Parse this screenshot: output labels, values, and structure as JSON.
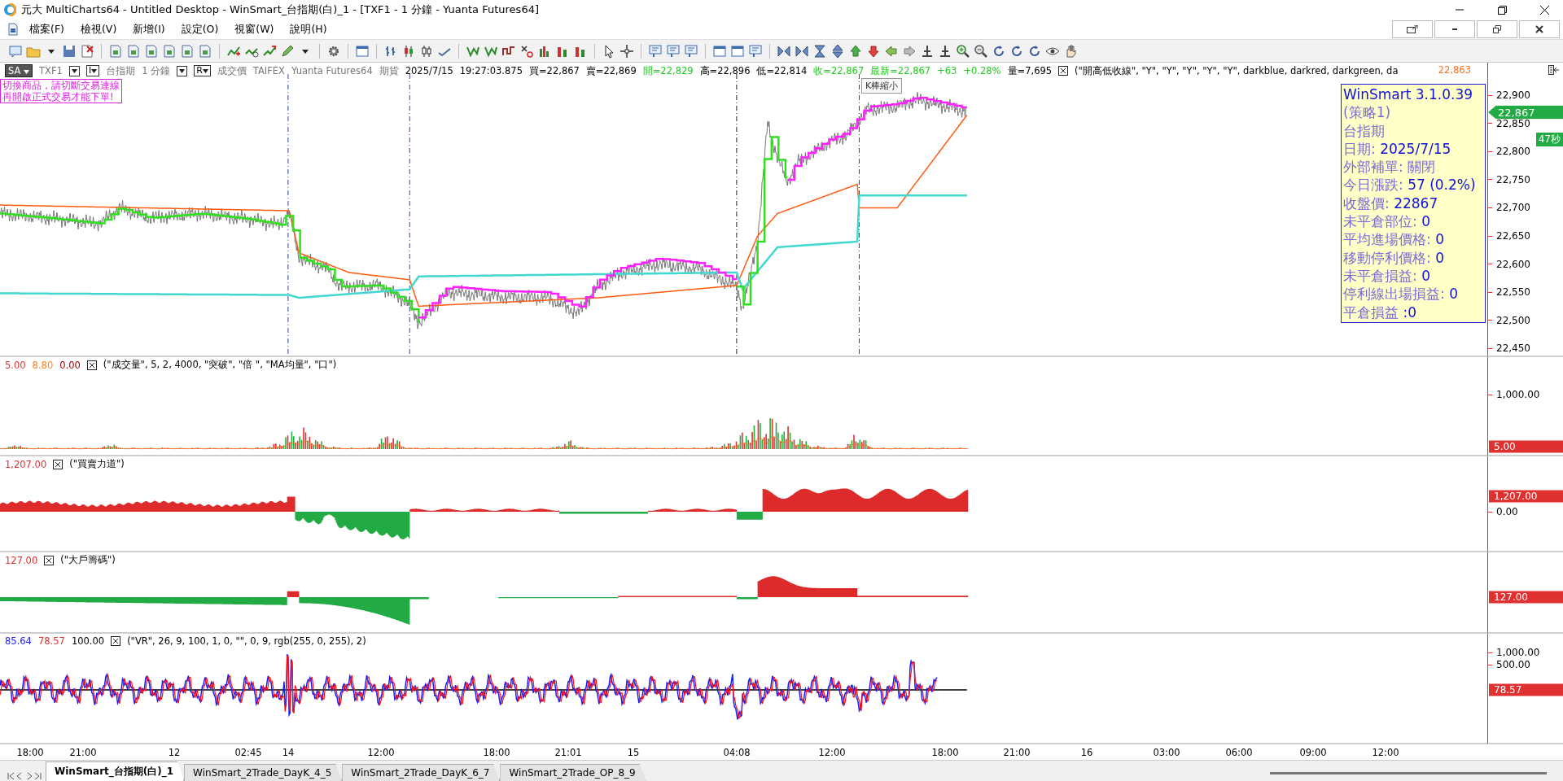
{
  "window": {
    "title": "元大 MultiCharts64 - Untitled Desktop - WinSmart_台指期(白)_1 - [TXF1 - 1 分鐘 - Yuanta Futures64]"
  },
  "menu": [
    "檔案(F)",
    "檢視(V)",
    "新增(I)",
    "設定(O)",
    "視窗(W)",
    "說明(H)"
  ],
  "main_chart": {
    "symbol_bar": [
      {
        "kind": "mode",
        "text": "SA"
      },
      {
        "kind": "text",
        "text": "TXF1"
      },
      {
        "kind": "dropdown"
      },
      {
        "kind": "button",
        "text": "I"
      },
      {
        "kind": "text",
        "text": "台指期"
      },
      {
        "kind": "text",
        "text": "1 分鐘"
      },
      {
        "kind": "dropdown"
      },
      {
        "kind": "button",
        "text": "R"
      },
      {
        "kind": "text",
        "text": "成交價"
      },
      {
        "kind": "text",
        "text": "TAIFEX"
      },
      {
        "kind": "text",
        "text": "Yuanta Futures64"
      },
      {
        "kind": "text",
        "text": "期貨"
      }
    ],
    "quotes": [
      {
        "text": "2025/7/15",
        "color": "#000000"
      },
      {
        "text": "19:27:03.875",
        "color": "#000000"
      },
      {
        "text": "買=22,867",
        "color": "#000000"
      },
      {
        "text": "賣=22,869",
        "color": "#000000"
      },
      {
        "text": "開=22,829",
        "color": "#22cc22"
      },
      {
        "text": "高=22,896",
        "color": "#000000"
      },
      {
        "text": "低=22,814",
        "color": "#000000"
      },
      {
        "text": "收=22,867",
        "color": "#22cc22"
      },
      {
        "text": "最新=22,867",
        "color": "#22cc22"
      },
      {
        "text": "+63",
        "color": "#22cc22"
      },
      {
        "text": "+0.28%",
        "color": "#22cc22"
      },
      {
        "text": "量=7,695",
        "color": "#000000"
      }
    ],
    "legend": "(\"開高低收線\", \"Y\", \"Y\", \"Y\", \"Y\", \"Y\", darkblue, darkred, darkgreen, da",
    "last_price": "22,863",
    "warning": [
      "切換商品，請切斷交易連線",
      "再開啟正式交易才能下單!"
    ],
    "tooltip": "K棒縮小",
    "info_box": [
      {
        "value": "WinSmart 3.1.0.39"
      },
      {
        "label": "(策略1)"
      },
      {
        "label": "台指期"
      },
      {
        "label": "日期: ",
        "value": "2025/7/15"
      },
      {
        "label": "外部補單: 關閉"
      },
      {
        "label": "今日漲跌: ",
        "value": "57 (0.2%)"
      },
      {
        "label": "收盤價: ",
        "value": "22867"
      },
      {
        "label": "未平倉部位: ",
        "value": "0"
      },
      {
        "label": "平均進場價格: ",
        "value": "0"
      },
      {
        "label": "移動停利價格: ",
        "value": "0"
      },
      {
        "label": "未平倉損益: ",
        "value": "0"
      },
      {
        "label": "停利線出場損益: ",
        "value": "0"
      },
      {
        "label": "平倉損益 ",
        "value": ":0"
      }
    ],
    "axis_ticks": [
      "22,900",
      "22,850",
      "22,800",
      "22,750",
      "22,700",
      "22,650",
      "22,600",
      "22,550",
      "22,500",
      "22,450"
    ],
    "price_tag": "22,867",
    "timer": "47秒"
  },
  "panels": [
    {
      "values": [
        {
          "text": "5.00",
          "color": "#e03030"
        },
        {
          "text": "8.80",
          "color": "#ff8020"
        },
        {
          "text": "0.00",
          "color": "#a00000"
        }
      ],
      "params": "(\"成交量\", 5, 2, 4000, \"突破\", \"倍 \", \"MA均量\", \"口\")",
      "axis": [
        {
          "kind": "tick",
          "text": "1,000.00"
        },
        {
          "kind": "tag",
          "text": "5.00",
          "color": "#e03030"
        }
      ]
    },
    {
      "values": [
        {
          "text": "1,207.00",
          "color": "#e03030"
        }
      ],
      "params": "(\"買賣力道\")",
      "axis": [
        {
          "kind": "tag",
          "text": "1,207.00",
          "color": "#e03030"
        },
        {
          "kind": "tick",
          "text": "0.00"
        }
      ]
    },
    {
      "values": [
        {
          "text": "127.00",
          "color": "#e03030"
        }
      ],
      "params": "(\"大戶籌碼\")",
      "axis": [
        {
          "kind": "tag",
          "text": "127.00",
          "color": "#e03030"
        }
      ]
    },
    {
      "values": [
        {
          "text": "85.64",
          "color": "#2020ff"
        },
        {
          "text": "78.57",
          "color": "#e03030"
        },
        {
          "text": "100.00",
          "color": "#000000"
        }
      ],
      "params": "(\"VR\", 26, 9, 100, 1, 0, \"\", 0, 9, rgb(255, 0, 255), 2)",
      "axis": [
        {
          "kind": "tick",
          "text": "1,000.00"
        },
        {
          "kind": "tick",
          "text": "500.00"
        },
        {
          "kind": "tag",
          "text": "78.57",
          "color": "#e03030"
        }
      ]
    }
  ],
  "time_axis": [
    "18:00",
    "21:00",
    "12",
    "02:45",
    "14",
    "12:00",
    "18:00",
    "21:01",
    "15",
    "04:08",
    "12:00",
    "18:00",
    "21:00",
    "16",
    "03:00",
    "06:00",
    "09:00",
    "12:00"
  ],
  "tabs": [
    {
      "label": "WinSmart_台指期(白)_1",
      "selected": true
    },
    {
      "label": "WinSmart_2Trade_DayK_4_5",
      "selected": false
    },
    {
      "label": "WinSmart_2Trade_DayK_6_7",
      "selected": false
    },
    {
      "label": "WinSmart_2Trade_OP_8_9",
      "selected": false
    }
  ]
}
